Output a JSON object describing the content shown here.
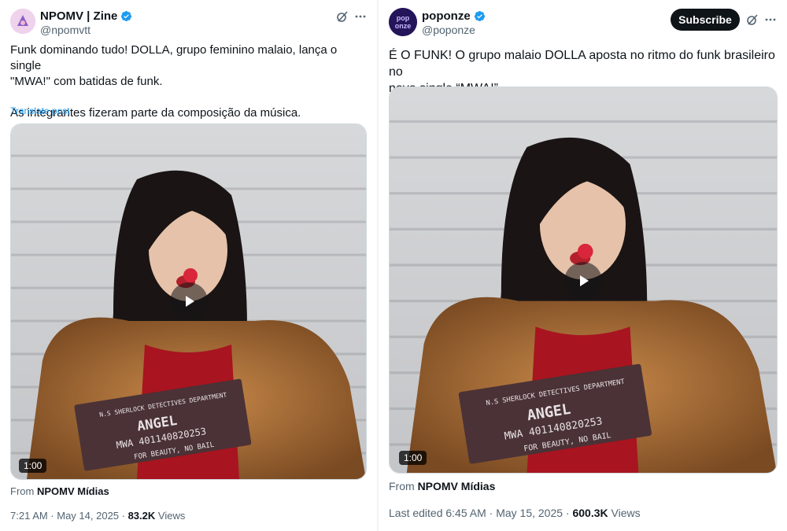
{
  "colors": {
    "accent": "#1d9bf0",
    "text": "#0f1419",
    "muted": "#536471"
  },
  "tweets": [
    {
      "author": {
        "name": "NPOMV | Zine",
        "handle": "@npomvtt",
        "verified": true,
        "avatar_icon": "npomv-avatar-icon"
      },
      "text_lines": [
        "Funk dominando tudo! DOLLA, grupo feminino malaio, lança o single",
        "\"MWA!\" com batidas de funk.",
        "",
        "As integrantes fizeram parte da composição da música."
      ],
      "translate_label": "Translate post",
      "video": {
        "duration": "1:00",
        "placard": {
          "header": "N.S SHERLOCK DETECTIVES DEPARTMENT",
          "name": "ANGEL",
          "number": "MWA 401140820253",
          "footer": "FOR BEAUTY, NO BAIL"
        }
      },
      "from_prefix": "From ",
      "from_source": "NPOMV Mídias",
      "timestamp": "7:21 AM · May 14, 2025 · ",
      "views_count": "83.2K",
      "views_label": " Views"
    },
    {
      "author": {
        "name": "poponze",
        "handle": "@poponze",
        "verified": true,
        "avatar_text": "pop\nonze"
      },
      "subscribe_label": "Subscribe",
      "text_lines": [
        "É O FUNK! O grupo malaio DOLLA aposta no ritmo do funk brasileiro no",
        "novo single “MWA!”."
      ],
      "video": {
        "duration": "1:00",
        "placard": {
          "header": "N.S SHERLOCK DETECTIVES DEPARTMENT",
          "name": "ANGEL",
          "number": "MWA 401140820253",
          "footer": "FOR BEAUTY, NO BAIL"
        }
      },
      "from_prefix": "From ",
      "from_source": "NPOMV Mídias",
      "timestamp": "Last edited 6:45 AM · May 15, 2025 · ",
      "views_count": "600.3K",
      "views_label": " Views"
    }
  ]
}
